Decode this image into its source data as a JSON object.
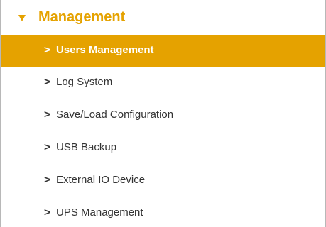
{
  "section": {
    "title": "Management",
    "expand_icon": "triangle-down-icon",
    "accent_color": "#e5a200"
  },
  "menu": {
    "chevron_glyph": ">",
    "items": [
      {
        "label": "Users Management",
        "active": true
      },
      {
        "label": "Log System",
        "active": false
      },
      {
        "label": "Save/Load Configuration",
        "active": false
      },
      {
        "label": "USB Backup",
        "active": false
      },
      {
        "label": "External IO Device",
        "active": false
      },
      {
        "label": "UPS Management",
        "active": false
      }
    ]
  }
}
